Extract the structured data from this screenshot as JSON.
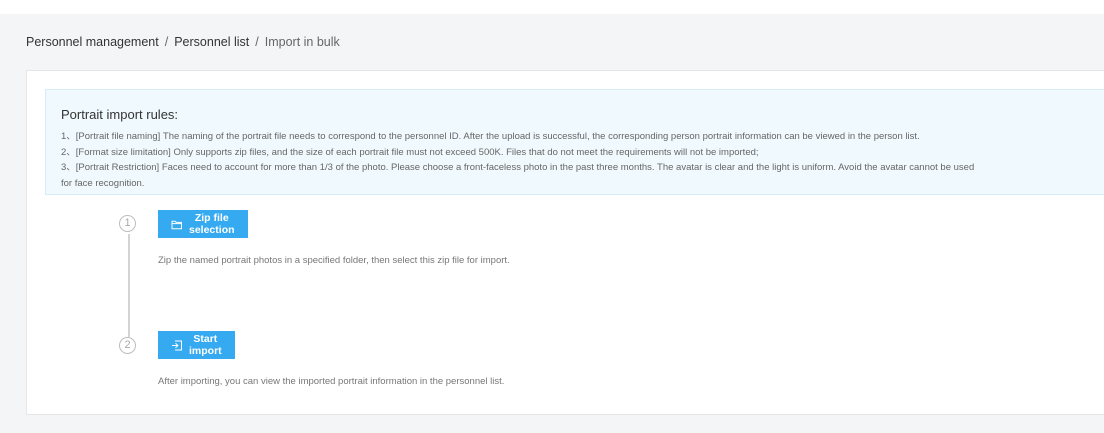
{
  "breadcrumb": {
    "items": [
      "Personnel management",
      "Personnel list",
      "Import in bulk"
    ],
    "separator": "/"
  },
  "rules": {
    "title": "Portrait import rules:",
    "lines": [
      "1、[Portrait file naming] The naming of the portrait file needs to correspond to the personnel ID. After the upload is successful, the corresponding person portrait information can be viewed in the person list.",
      "2、[Format size limitation] Only supports zip files, and the size of each portrait file must not exceed 500K. Files that do not meet the requirements will not be imported;",
      "3、[Portrait Restriction] Faces need to account for more than 1/3 of the photo. Please choose a front-faceless photo in the past three months. The avatar is clear and the light is uniform. Avoid the avatar cannot be used",
      "for face recognition."
    ]
  },
  "steps": [
    {
      "number": "1",
      "button_label": "Zip file selection",
      "button_icon": "folder-icon",
      "description": "Zip the named portrait photos in a specified folder, then select this zip file for import."
    },
    {
      "number": "2",
      "button_label": "Start import",
      "button_icon": "import-icon",
      "description": "After importing, you can view the imported portrait information in the personnel list."
    }
  ],
  "colors": {
    "primary_button": "#35aaf0",
    "rules_background": "#f0f9fd",
    "page_background": "#f4f5f6"
  }
}
